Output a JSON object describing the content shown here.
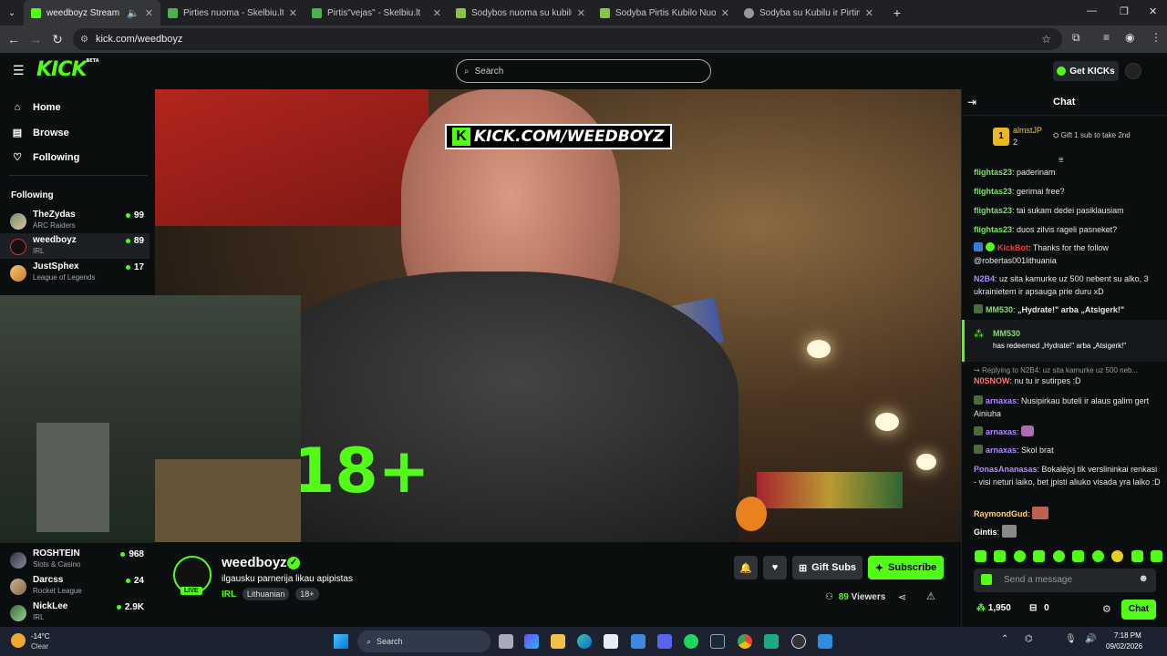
{
  "browser": {
    "tabs": [
      {
        "title": "weedboyz Stream - Watch l",
        "active": true,
        "color": "#53fc18"
      },
      {
        "title": "Pirties nuoma - Skelbiu.lt",
        "active": false,
        "color": "#4caf50"
      },
      {
        "title": "Pirtis\"vejas\" - Skelbiu.lt",
        "active": false,
        "color": "#4caf50"
      },
      {
        "title": "Sodybos nuoma su kubilu,džiak",
        "active": false,
        "color": "#8bc34a"
      },
      {
        "title": "Sodyba Pirtis Kubilo Nuoma so",
        "active": false,
        "color": "#8bc34a"
      },
      {
        "title": "Sodyba su Kubilu ir Pirtimi - Nu",
        "active": false,
        "color": "#999999"
      }
    ],
    "url": "kick.com/weedboyz"
  },
  "header": {
    "logo": "KICK",
    "logo_badge": "BETA",
    "search_placeholder": "Search",
    "get_kicks": "Get KICKs"
  },
  "sidebar": {
    "nav": [
      {
        "label": "Home",
        "icon": "home-icon"
      },
      {
        "label": "Browse",
        "icon": "browse-icon"
      },
      {
        "label": "Following",
        "icon": "heart-icon"
      }
    ],
    "following_heading": "Following",
    "following": [
      {
        "name": "TheZydas",
        "category": "ARC Raiders",
        "viewers": "99"
      },
      {
        "name": "weedboyz",
        "category": "IRL",
        "viewers": "89"
      },
      {
        "name": "JustSphex",
        "category": "League of Legends",
        "viewers": "17"
      }
    ],
    "recommended": [
      {
        "name": "ROSHTEIN",
        "category": "Slots & Casino",
        "viewers": "968"
      },
      {
        "name": "Darcss",
        "category": "Rocket League",
        "viewers": "24"
      },
      {
        "name": "NickLee",
        "category": "IRL",
        "viewers": "2.9K"
      }
    ]
  },
  "video": {
    "overlay_url": "KICK.COM/WEEDBOYZ",
    "overlay_age": "18+"
  },
  "stream": {
    "channel": "weedboyz",
    "title": "ilgausku parnerija likau apipistas",
    "category": "IRL",
    "tags": [
      "Lithuanian",
      "18+"
    ],
    "live_label": "LIVE",
    "viewers": "89",
    "viewers_label": "Viewers",
    "gift_subs": "Gift Subs",
    "subscribe": "Subscribe"
  },
  "chat": {
    "title": "Chat",
    "top_gifter": {
      "rank": "1",
      "name": "almstJP",
      "count": "2",
      "note": "Gift 1 sub to take 2nd"
    },
    "messages": [
      {
        "user": "flightas23",
        "color": "#7ee069",
        "text": "paderinam"
      },
      {
        "user": "flightas23",
        "color": "#7ee069",
        "text": "gerimai free?"
      },
      {
        "user": "flightas23",
        "color": "#7ee069",
        "text": "tai sukam dedei pasiklausiam"
      },
      {
        "user": "flightas23",
        "color": "#7ee069",
        "text": "duos zilvis rageli pasneket?"
      },
      {
        "user": "KickBot",
        "color": "#f23c3c",
        "text": "Thanks for the follow @robertas001lithuania"
      },
      {
        "user": "N2B4",
        "color": "#b388ff",
        "text": "uz sita kamurke uz 500 nebent su alko, 3 ukrainietem ir apsauga prie duru xD"
      },
      {
        "user": "MM530",
        "color": "#7ee069",
        "text": "„Hydrate!\" arba „Atsigerk!\""
      }
    ],
    "redeem": {
      "user": "MM530",
      "text": "has redeemed „Hydrate!\" arba „Atsigerk!\""
    },
    "reply_context": "Replying to N2B4: uz sita kamurke uz 500 neb...",
    "messages2": [
      {
        "user": "N0SNOW",
        "color": "#ff7070",
        "text": "nu tu ir sutirpes :D"
      },
      {
        "user": "arnaxas",
        "color": "#b388ff",
        "text": "Nusipirkau buteli ir alaus galim gert Ainiuha"
      },
      {
        "user": "arnaxas",
        "color": "#b388ff",
        "text": ""
      },
      {
        "user": "arnaxas",
        "color": "#b388ff",
        "text": "Skol brat"
      },
      {
        "user": "PonasAnanasas",
        "color": "#b388ff",
        "text": "Bokalėjoj tik verslininkai renkasi - visi neturi laiko, bet jpisti aliuko visada yra laiko :D"
      },
      {
        "user": "RaymondGud",
        "color": "#ffd36b",
        "text": ""
      },
      {
        "user": "Gintis",
        "color": "#ffffff",
        "text": ""
      }
    ],
    "input_placeholder": "Send a message",
    "kicks_balance": "1,950",
    "bag_count": "0",
    "chat_button": "Chat"
  },
  "taskbar": {
    "weather_temp": "-14°C",
    "weather_desc": "Clear",
    "search": "Search",
    "time": "7:18 PM",
    "date": "09/02/2026"
  }
}
